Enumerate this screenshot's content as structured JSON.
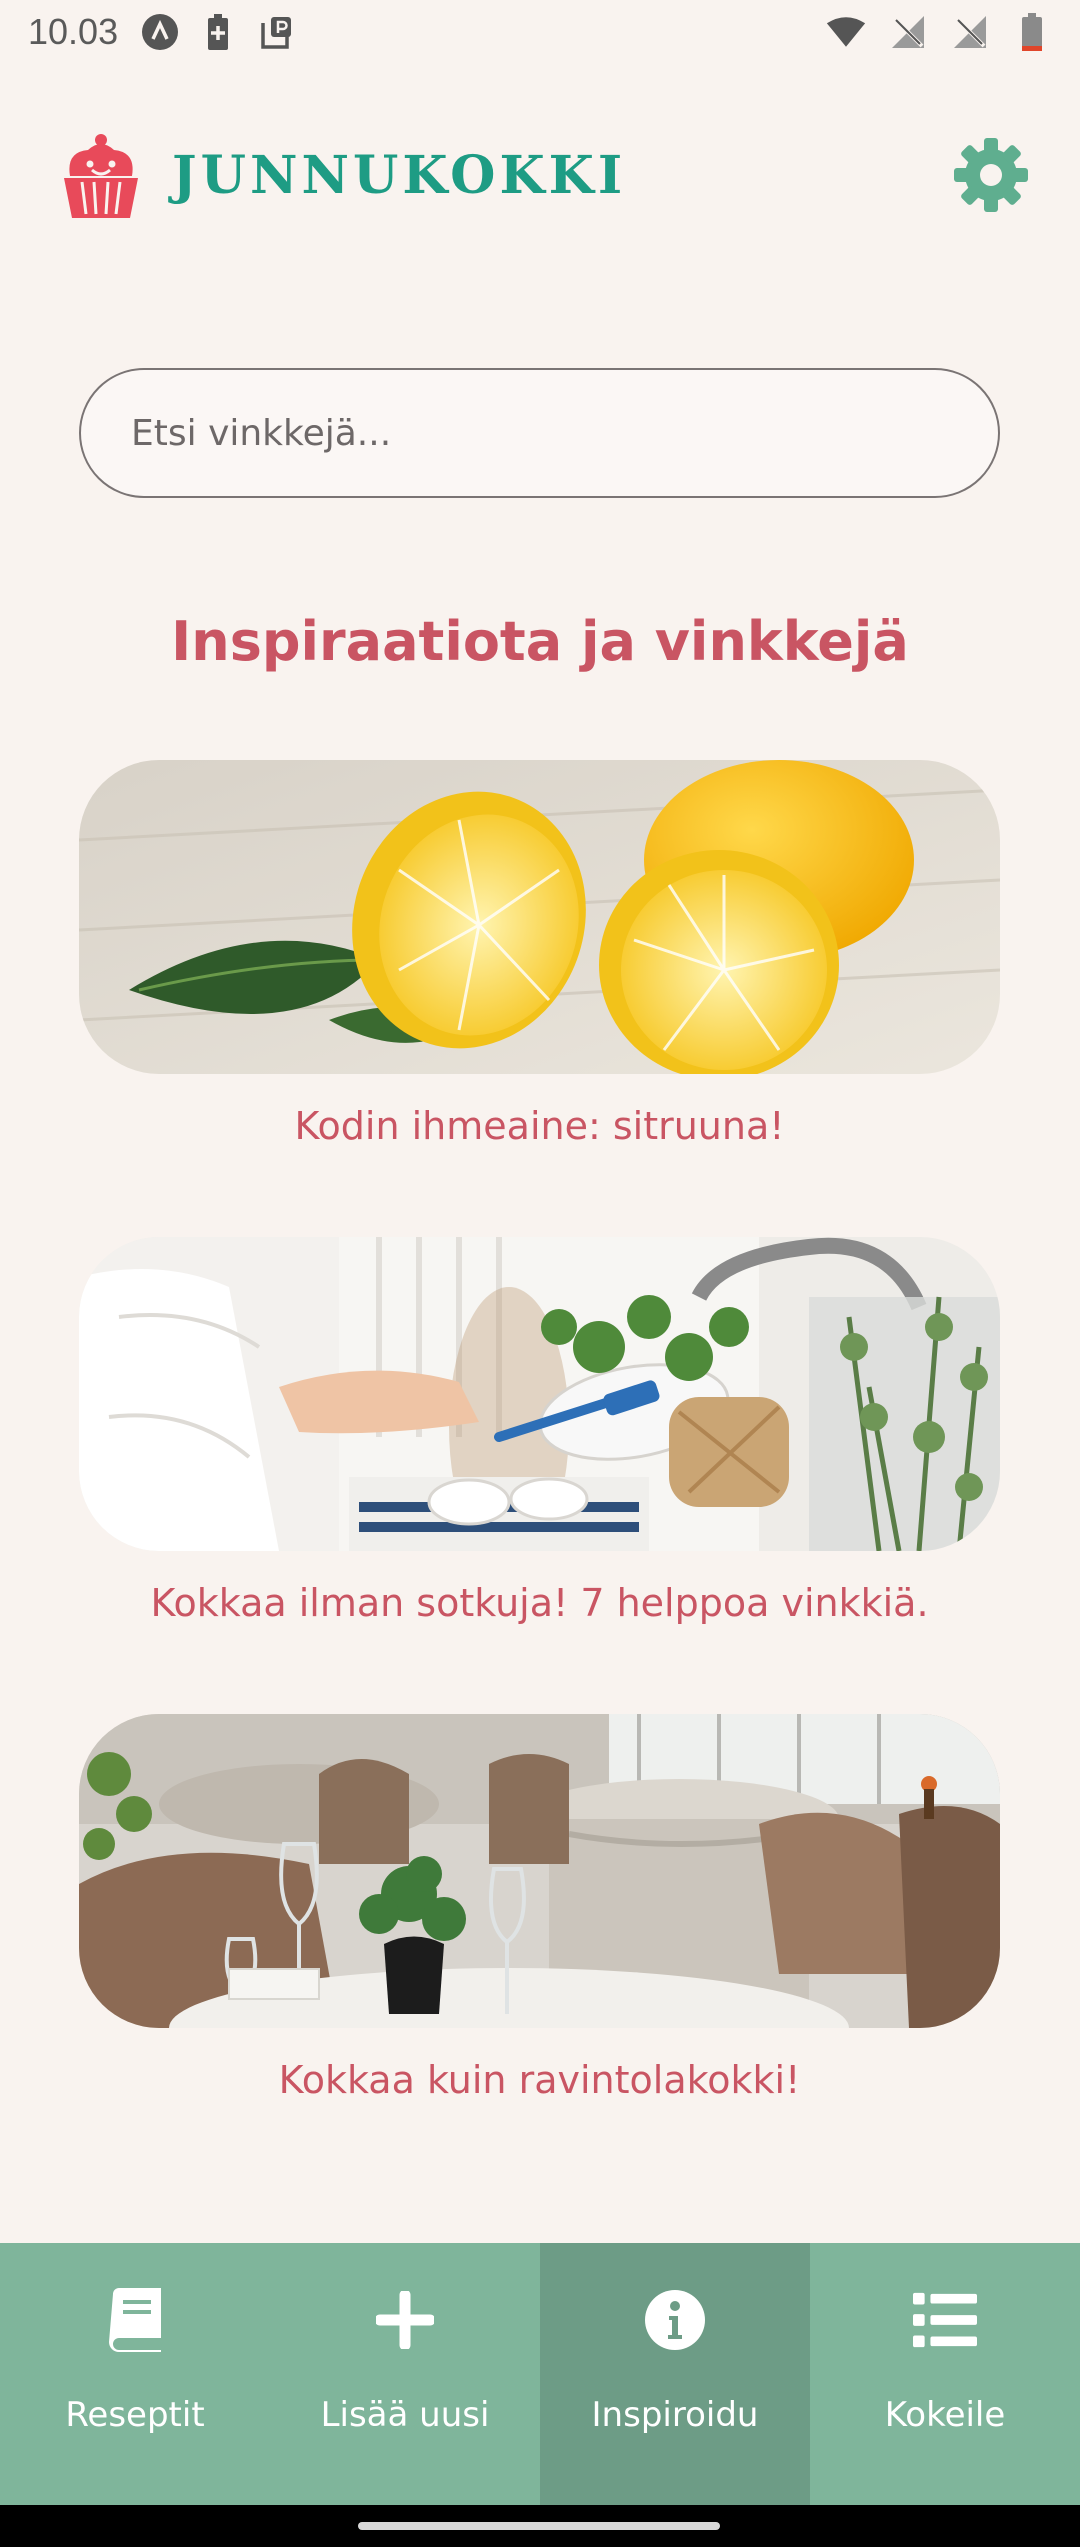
{
  "status_bar": {
    "time": "10.03",
    "icons": [
      "android-icon",
      "battery-saver-icon",
      "parking-icon",
      "wifi-icon",
      "no-signal-icon",
      "no-signal-icon",
      "battery-low-icon"
    ]
  },
  "header": {
    "app_name": "JUNNUKOKKI",
    "logo_icon": "cupcake-icon",
    "settings_icon": "gear-icon"
  },
  "search": {
    "placeholder": "Etsi vinkkejä...",
    "value": ""
  },
  "main": {
    "section_title": "Inspiraatiota ja vinkkejä",
    "cards": [
      {
        "caption": "Kodin ihmeaine: sitruuna!",
        "image": "lemons-image"
      },
      {
        "caption": "Kokkaa ilman sotkuja! 7 helppoa vinkkiä.",
        "image": "dishwashing-image"
      },
      {
        "caption": "Kokkaa kuin ravintolakokki!",
        "image": "restaurant-image"
      }
    ]
  },
  "bottom_nav": {
    "items": [
      {
        "label": "Reseptit",
        "icon": "book-icon",
        "active": false
      },
      {
        "label": "Lisää uusi",
        "icon": "plus-icon",
        "active": false
      },
      {
        "label": "Inspiroidu",
        "icon": "info-icon",
        "active": true
      },
      {
        "label": "Kokeile",
        "icon": "list-icon",
        "active": false
      }
    ]
  },
  "colors": {
    "background": "#f9f3ef",
    "brand_green": "#1e9c84",
    "accent_red": "#c95563",
    "nav_background": "#7fb59b",
    "nav_active": "#6d9c86"
  }
}
